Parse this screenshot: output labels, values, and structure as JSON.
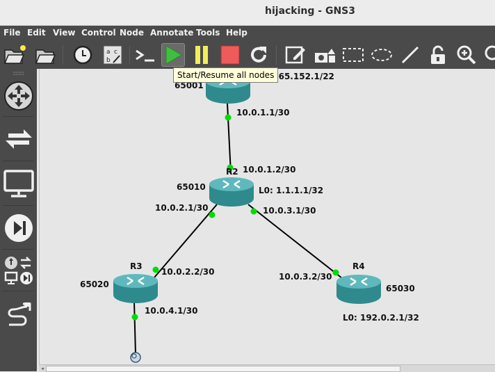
{
  "window": {
    "title": "hijacking - GNS3"
  },
  "menu": [
    "File",
    "Edit",
    "View",
    "Control",
    "Node",
    "Annotate",
    "Tools",
    "Help"
  ],
  "toolbar": {
    "buttons": [
      "open-project-icon",
      "open-folder-icon",
      "clock-icon",
      "label-icon",
      "console-icon",
      "start-icon",
      "pause-icon",
      "stop-icon",
      "reload-icon",
      "edit-note-icon",
      "insert-image-icon",
      "rectangle-icon",
      "ellipse-icon",
      "line-icon",
      "unlock-icon",
      "zoom-in-icon"
    ],
    "tooltip": "Start/Resume all nodes"
  },
  "sidebar": [
    "routers-icon",
    "switches-icon",
    "end-devices-icon",
    "security-devices-icon",
    "all-devices-icon",
    "add-link-icon"
  ],
  "topology": {
    "nodes": [
      {
        "id": "R1",
        "name": "",
        "asn": "65001",
        "info": "208.65.152.1/22"
      },
      {
        "id": "R2",
        "name": "R2",
        "asn": "65010",
        "info": "L0: 1.1.1.1/32"
      },
      {
        "id": "R3",
        "name": "R3",
        "asn": "65020",
        "info": ""
      },
      {
        "id": "R4",
        "name": "R4",
        "asn": "65030",
        "info": "L0: 192.0.2.1/32"
      }
    ],
    "links": [
      {
        "a": "10.0.1.1/30",
        "b": "10.0.1.2/30"
      },
      {
        "a": "10.0.2.1/30",
        "b": "10.0.2.2/30"
      },
      {
        "a": "10.0.3.1/30",
        "b": "10.0.3.2/30"
      },
      {
        "a": "10.0.4.1/30",
        "b": ""
      }
    ]
  },
  "colors": {
    "toolbar": "#4a4a4a",
    "link_up": "#00dd00",
    "router": "#3f9b9e"
  }
}
